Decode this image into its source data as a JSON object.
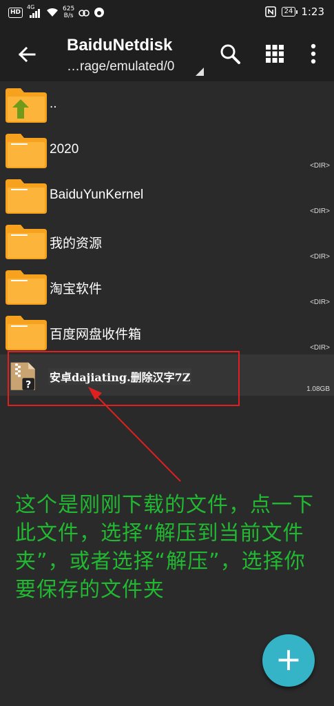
{
  "status_bar": {
    "hd": "HD",
    "network": "4G",
    "speed_top": "625",
    "speed_bottom": "B/s",
    "battery": "24",
    "time": "1:23"
  },
  "toolbar": {
    "title": "BaiduNetdisk",
    "path": "…rage/emulated/0"
  },
  "files": [
    {
      "name": "..",
      "meta": "",
      "icon": "parent-folder-icon"
    },
    {
      "name": "2020",
      "meta": "<DIR>",
      "icon": "folder-icon"
    },
    {
      "name": "BaiduYunKernel",
      "meta": "<DIR>",
      "icon": "folder-icon"
    },
    {
      "name": "我的资源",
      "meta": "<DIR>",
      "icon": "folder-icon"
    },
    {
      "name": "淘宝软件",
      "meta": "<DIR>",
      "icon": "folder-icon"
    },
    {
      "name": "百度网盘收件箱",
      "meta": "<DIR>",
      "icon": "folder-icon"
    },
    {
      "name": "安卓dajiating.删除汉字7Z",
      "meta": "1.08GB",
      "icon": "archive-file-icon"
    }
  ],
  "annotation": {
    "text": "这个是刚刚下载的文件，点一下此文件，选择“解压到当前文件夹”，或者选择“解压”，选择你要保存的文件夹",
    "color": "#22b832",
    "highlight_color": "#e02020"
  },
  "fab": {
    "label": "+",
    "color": "#35b3c7"
  }
}
